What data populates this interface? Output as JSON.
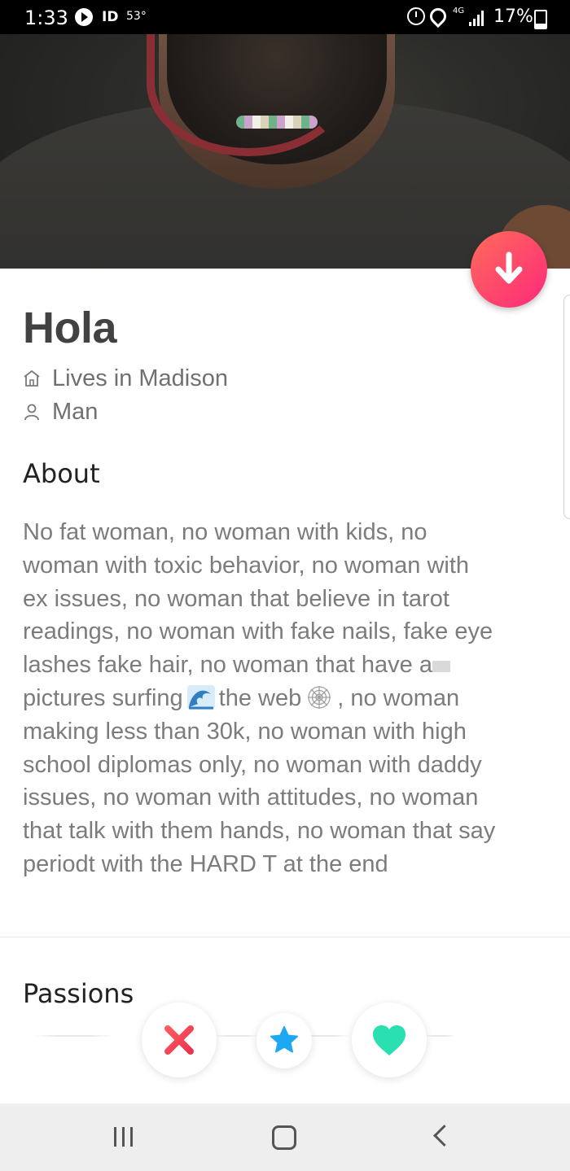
{
  "status_bar": {
    "time": "1:33",
    "id_label": "ID",
    "temperature": "53°",
    "network": "4G",
    "battery": "17%"
  },
  "profile": {
    "name": "Hola",
    "location": "Lives in Madison",
    "gender": "Man"
  },
  "about": {
    "title": "About",
    "lines": [
      "No fat woman, no woman with kids, no",
      "woman with toxic behavior, no woman with",
      "ex issues, no woman that believe in tarot",
      "readings, no woman with fake nails, fake eye",
      "lashes fake hair, no woman that have a",
      "pictures surfing",
      "the web",
      ", no woman",
      "making less than 30k, no woman with high",
      "school diplomas only, no woman with daddy",
      "issues, no woman with attitudes, no woman",
      "that talk with them hands, no woman that say",
      "periodt with the HARD T at the end"
    ]
  },
  "passions": {
    "title": "Passions"
  },
  "actions": {
    "nope_icon": "close-icon",
    "super_like_icon": "star-icon",
    "like_icon": "heart-icon"
  },
  "colors": {
    "brand_gradient_start": "#ff6b5a",
    "brand_gradient_end": "#fd297b",
    "nope": "#f14a56",
    "super_like": "#1ea8f2",
    "like": "#2ae0b0"
  }
}
